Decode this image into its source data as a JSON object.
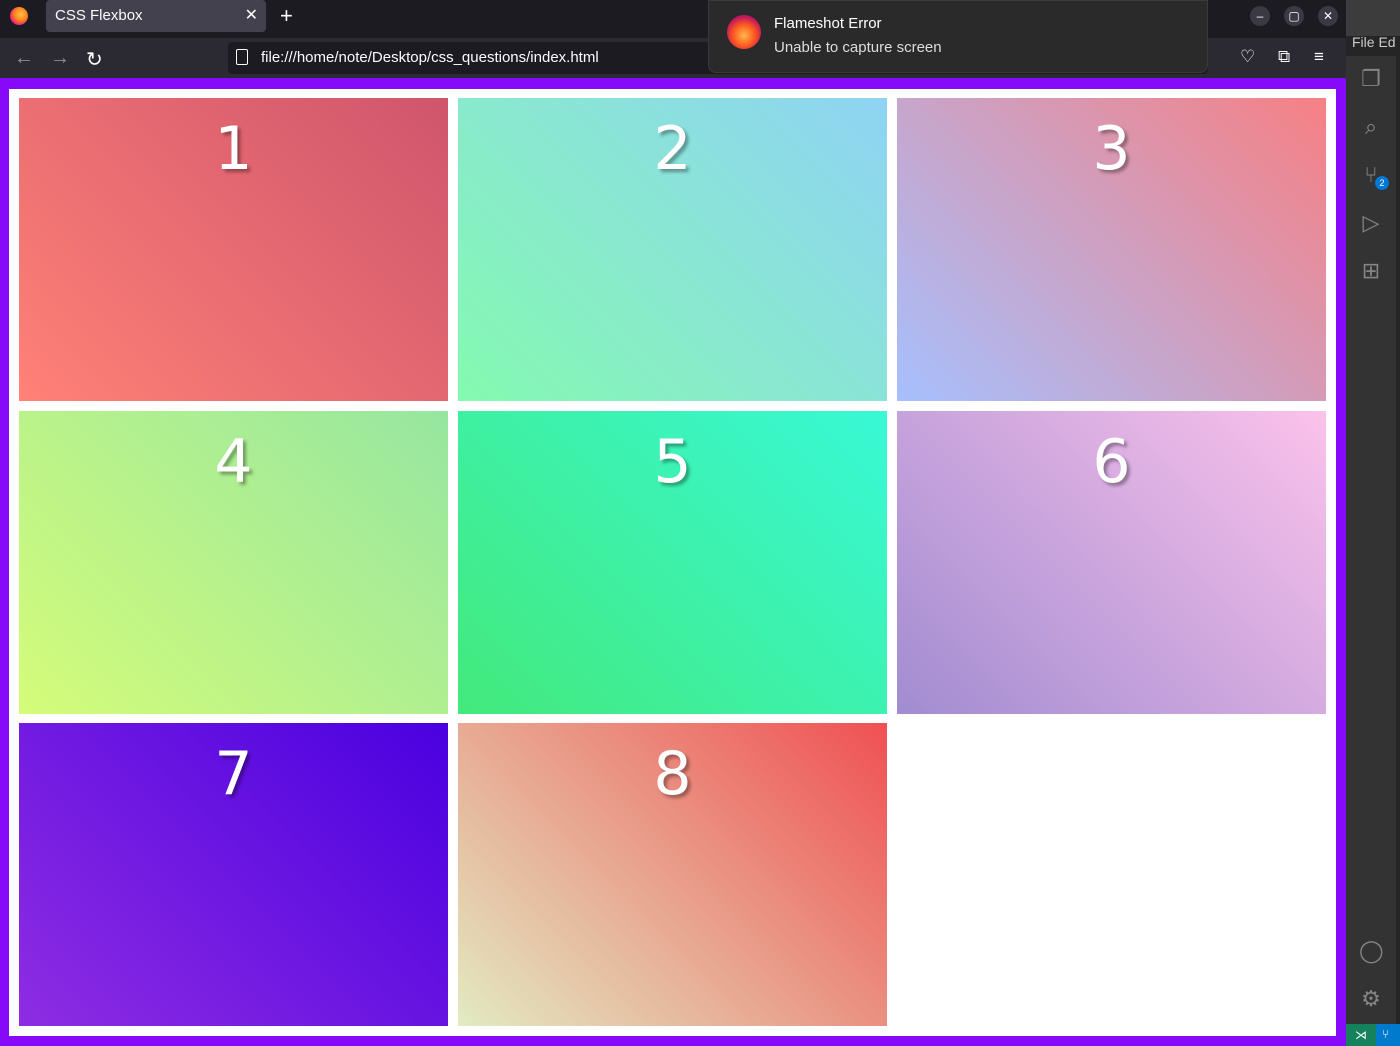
{
  "browser": {
    "tab_title": "CSS Flexbox",
    "tab_close": "✕",
    "new_tab": "+",
    "url": "file:///home/note/Desktop/css_questions/index.html",
    "back": "←",
    "forward": "→",
    "reload": "↻",
    "minimize": "–",
    "maximize": "▢",
    "close": "✕"
  },
  "notification": {
    "title": "Flameshot Error",
    "body": "Unable to capture screen"
  },
  "boxes": [
    {
      "label": "1",
      "gradient": [
        "#ff8177",
        "#cf556c"
      ]
    },
    {
      "label": "2",
      "gradient": [
        "#84fab0",
        "#8fd3f4"
      ]
    },
    {
      "label": "3",
      "gradient": [
        "#a6c0fe",
        "#f68084"
      ]
    },
    {
      "label": "4",
      "gradient": [
        "#d4fc79",
        "#96e6a1"
      ]
    },
    {
      "label": "5",
      "gradient": [
        "#43e97b",
        "#38f9d7"
      ]
    },
    {
      "label": "6",
      "gradient": [
        "#a18cd1",
        "#fbc2eb"
      ]
    },
    {
      "label": "7",
      "gradient": [
        "#8e2de2",
        "#4a00e0"
      ]
    },
    {
      "label": "8",
      "gradient": [
        "#e2ebc2",
        "#f05053"
      ]
    }
  ],
  "page_background": "#8609f9",
  "vscode": {
    "menu": "File  Ed",
    "scm_badge": "2"
  }
}
